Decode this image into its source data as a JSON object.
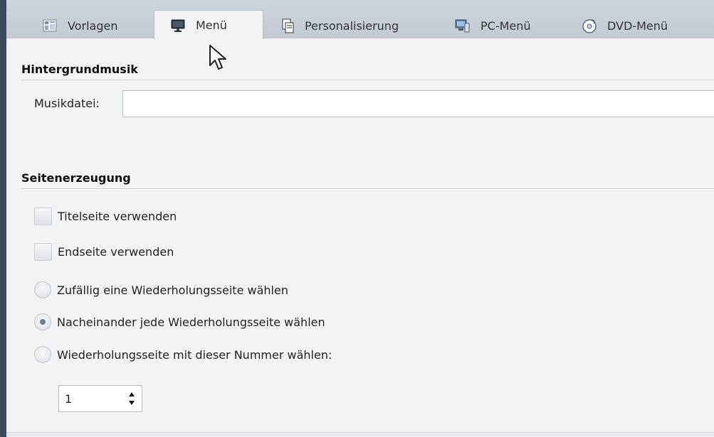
{
  "tabs": [
    {
      "label": "Vorlagen",
      "icon": "templates-icon"
    },
    {
      "label": "Menü",
      "icon": "monitor-icon",
      "active": true
    },
    {
      "label": "Personalisierung",
      "icon": "copy-pages-icon"
    },
    {
      "label": "PC-Menü",
      "icon": "pc-menu-icon"
    },
    {
      "label": "DVD-Menü",
      "icon": "dvd-disc-icon"
    }
  ],
  "background_music": {
    "heading": "Hintergrundmusik",
    "file_label": "Musikdatei:",
    "file_value": ""
  },
  "page_generation": {
    "heading": "Seitenerzeugung",
    "title_page_label": "Titelseite verwenden",
    "end_page_label": "Endseite verwenden",
    "random_repeat_label": "Zufällig eine Wiederholungsseite wählen",
    "sequential_repeat_label": "Nacheinander jede Wiederholungsseite wählen",
    "number_repeat_label": "Wiederholungsseite mit dieser Nummer wählen:",
    "selected_option": "sequential",
    "repeat_number": "1"
  },
  "colors": {
    "accent_dark": "#3c4a5c",
    "panel_bg": "#f3f3f3",
    "tab_bar": "#c9d0d8"
  }
}
